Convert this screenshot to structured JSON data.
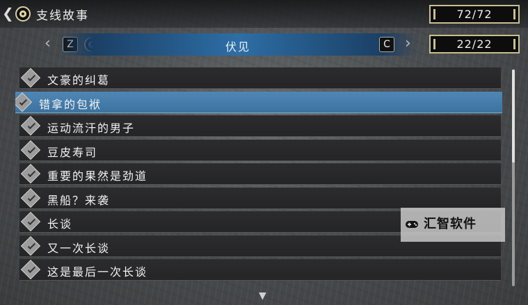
{
  "header": {
    "back_icon": "chevron-left-icon",
    "title": "支线故事",
    "total_counter": "72/72"
  },
  "category": {
    "prev_key": "Z",
    "next_key": "C",
    "label": "伏见",
    "counter": "22/22"
  },
  "list": {
    "selected_index": 1,
    "items": [
      {
        "label": "文豪的纠葛",
        "completed": true
      },
      {
        "label": "错拿的包袱",
        "completed": true
      },
      {
        "label": "运动流汗的男子",
        "completed": true
      },
      {
        "label": "豆皮寿司",
        "completed": true
      },
      {
        "label": "重要的果然是劲道",
        "completed": true
      },
      {
        "label": "黑船？来袭",
        "completed": true
      },
      {
        "label": "长谈",
        "completed": true
      },
      {
        "label": "又一次长谈",
        "completed": true
      },
      {
        "label": "这是最后一次长谈",
        "completed": true
      }
    ]
  },
  "scroll": {
    "position_fraction": 0.0,
    "visible_fraction": 0.43
  },
  "watermark": {
    "text": "汇智软件"
  },
  "colors": {
    "accent_blue": "#3d729f",
    "frame_gold": "#c9c08e"
  }
}
